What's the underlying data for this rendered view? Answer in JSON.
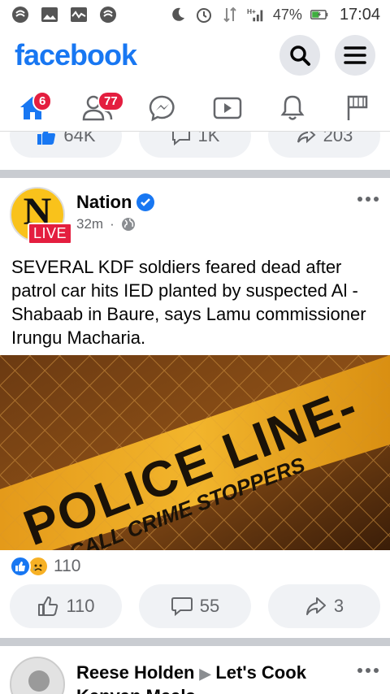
{
  "status_bar": {
    "battery": "47%",
    "time": "17:04"
  },
  "header": {
    "logo": "facebook",
    "icons": [
      "search-icon",
      "menu-icon"
    ]
  },
  "nav": {
    "tabs": [
      {
        "name": "home",
        "icon": "home-icon",
        "badge": "6"
      },
      {
        "name": "friends",
        "icon": "friends-icon",
        "badge": "77"
      },
      {
        "name": "messenger",
        "icon": "messenger-icon",
        "badge": ""
      },
      {
        "name": "watch",
        "icon": "watch-icon",
        "badge": ""
      },
      {
        "name": "notifications",
        "icon": "bell-icon",
        "badge": ""
      },
      {
        "name": "pages",
        "icon": "flag-icon",
        "badge": ""
      }
    ]
  },
  "prev_post": {
    "likes": "64K",
    "comments": "1K",
    "shares": "203"
  },
  "post": {
    "page_name": "Nation",
    "avatar_letter": "N",
    "live_label": "LIVE",
    "time": "32m",
    "separator": "·",
    "text": "SEVERAL KDF soldiers feared dead after patrol car hits IED planted by suspected Al -Shabaab in Baure, says Lamu commissioner Irungu Macharia.",
    "reaction_count": "110",
    "likes": "110",
    "comments": "55",
    "shares": "3"
  },
  "next_post": {
    "author": "Reese Holden",
    "group": "Let's Cook Kenyan Meals"
  },
  "colors": {
    "brand": "#1877f2",
    "badge": "#e41e3f",
    "pill_bg": "#f0f2f5",
    "separator": "#c9ccd1"
  }
}
